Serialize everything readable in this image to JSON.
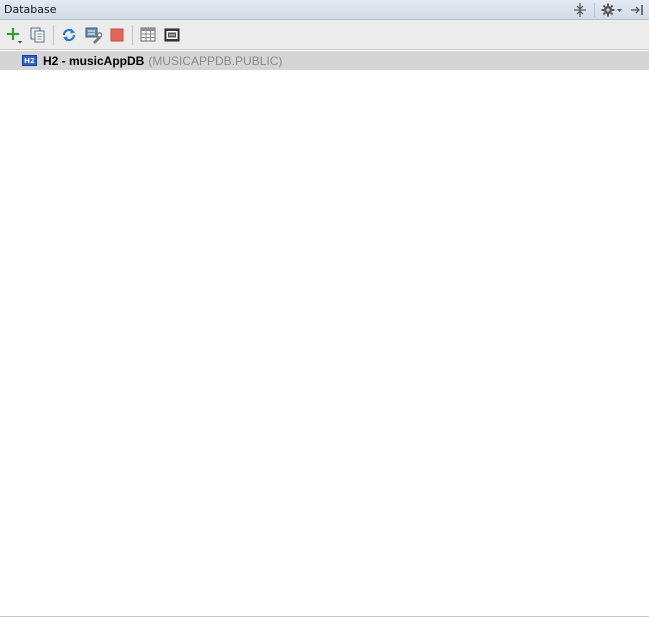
{
  "panel": {
    "title": "Database"
  },
  "header_icons": [
    "collapse-all-icon",
    "gear-icon",
    "hide-panel-icon"
  ],
  "toolbar": {
    "items": [
      "add-icon",
      "copy-icon",
      "refresh-icon",
      "properties-icon",
      "stop-icon",
      "table-icon",
      "console-icon"
    ]
  },
  "tree": {
    "datasource": {
      "badge": "H2",
      "name": "H2 - musicAppDB",
      "schema": "(MUSICAPPDB.PUBLIC)"
    }
  },
  "colors": {
    "accent_badge": "#2e5fd1",
    "selected_row": "#d5d5d5",
    "stop_red": "#e0685b",
    "add_green": "#3a9a3a",
    "refresh_blue": "#2a78c9"
  }
}
